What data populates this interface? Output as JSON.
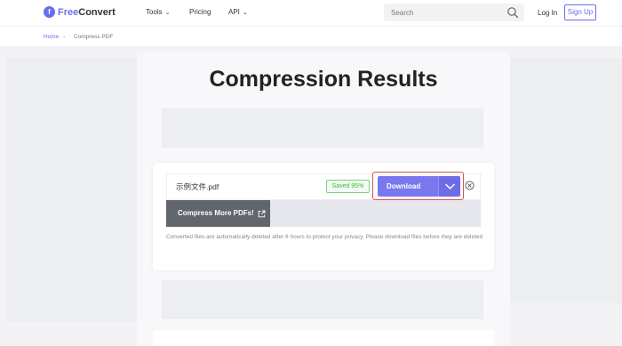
{
  "header": {
    "logo_icon": "f",
    "logo_brand": "Free",
    "logo_brand_rest": "Convert",
    "nav": {
      "tools": "Tools",
      "pricing": "Pricing",
      "api": "API"
    },
    "search_placeholder": "Search",
    "login": "Log In",
    "signup": "Sign Up"
  },
  "breadcrumb": {
    "home": "Home",
    "separator": "›",
    "current": "Compress PDF"
  },
  "main": {
    "title": "Compression Results",
    "file": {
      "name": "示例文件.pdf",
      "saved_badge": "Saved 95%",
      "download_label": "Download"
    },
    "compress_more": "Compress More PDFs!",
    "notice": "Converted files are automatically deleted after 8 hours to protect your privacy. Please download files before they are deleted"
  },
  "colors": {
    "brand": "#6c6ef0",
    "download": "#7a78ee",
    "saved_green": "#44b53b",
    "highlight_red": "#e05050",
    "compress_button": "#61666d"
  },
  "icons": [
    "search-icon",
    "chevron-down-icon",
    "remove-icon",
    "external-link-icon"
  ]
}
